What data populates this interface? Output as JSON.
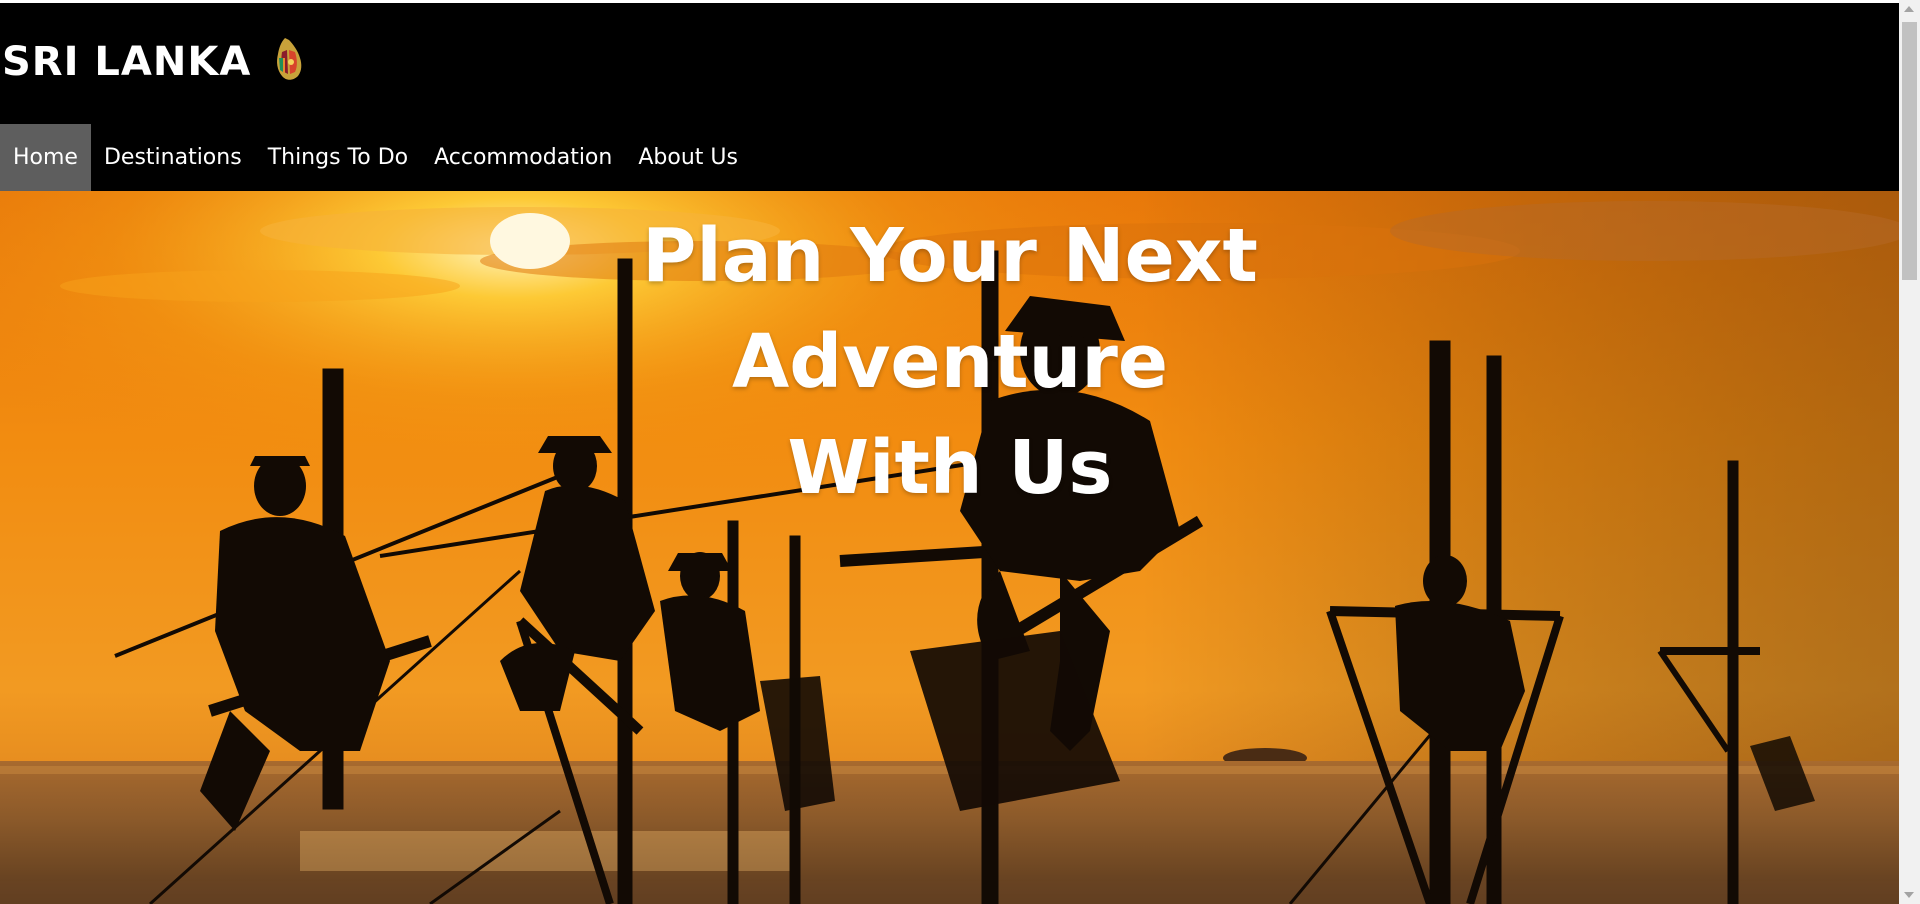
{
  "header": {
    "title": "SRI LANKA",
    "logo_icon": "sri-lanka-flag-map-icon"
  },
  "nav": {
    "items": [
      {
        "label": "Home",
        "active": true
      },
      {
        "label": "Destinations",
        "active": false
      },
      {
        "label": "Things To Do",
        "active": false
      },
      {
        "label": "Accommodation",
        "active": false
      },
      {
        "label": "About Us",
        "active": false
      }
    ]
  },
  "hero": {
    "heading": "Plan Your Next Adventure With Us",
    "image_icon": "stilt-fishermen-sunset-photo"
  },
  "colors": {
    "header_bg": "#000000",
    "nav_active_bg": "#5e5e5e",
    "text": "#ffffff",
    "sunset_orange": "#f28a00"
  }
}
